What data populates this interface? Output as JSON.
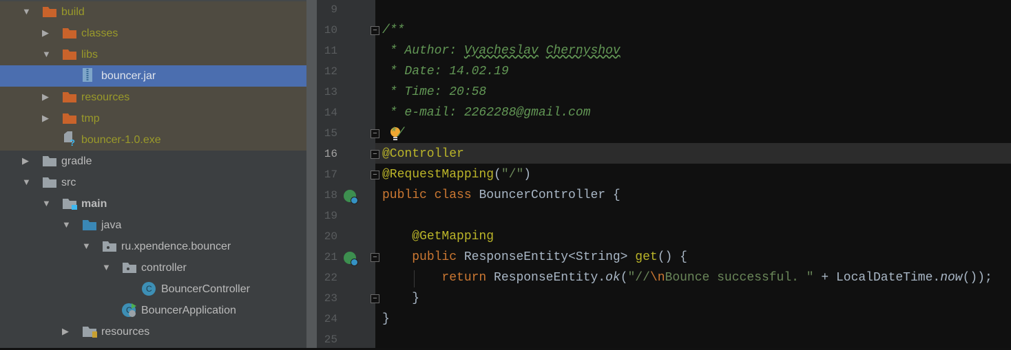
{
  "tree": [
    {
      "label": "build",
      "level": 1,
      "arrow": "open",
      "icon": "folder-orange",
      "style": "bld olive"
    },
    {
      "label": "classes",
      "level": 2,
      "arrow": "closed",
      "icon": "folder-orange",
      "style": "bld olive"
    },
    {
      "label": "libs",
      "level": 2,
      "arrow": "open",
      "icon": "folder-orange",
      "style": "bld olive"
    },
    {
      "label": "bouncer.jar",
      "level": 3,
      "arrow": "",
      "icon": "jar",
      "style": "sel"
    },
    {
      "label": "resources",
      "level": 2,
      "arrow": "closed",
      "icon": "folder-orange",
      "style": "bld olive"
    },
    {
      "label": "tmp",
      "level": 2,
      "arrow": "closed",
      "icon": "folder-orange",
      "style": "bld olive"
    },
    {
      "label": "bouncer-1.0.exe",
      "level": 2,
      "arrow": "",
      "icon": "unknown-file",
      "style": "bld olive"
    },
    {
      "label": "gradle",
      "level": 1,
      "arrow": "closed",
      "icon": "folder-gray",
      "style": ""
    },
    {
      "label": "src",
      "level": 1,
      "arrow": "open",
      "icon": "folder-gray",
      "style": ""
    },
    {
      "label": "main",
      "level": 2,
      "arrow": "open",
      "icon": "folder-source-root",
      "style": "bold"
    },
    {
      "label": "java",
      "level": 3,
      "arrow": "open",
      "icon": "folder-blue",
      "style": ""
    },
    {
      "label": "ru.xpendence.bouncer",
      "level": 4,
      "arrow": "open",
      "icon": "package",
      "style": ""
    },
    {
      "label": "controller",
      "level": 5,
      "arrow": "open",
      "icon": "package",
      "style": ""
    },
    {
      "label": "BouncerController",
      "level": 6,
      "arrow": "",
      "icon": "class",
      "style": ""
    },
    {
      "label": "BouncerApplication",
      "level": 5,
      "arrow": "",
      "icon": "spring-app-class",
      "style": ""
    },
    {
      "label": "resources",
      "level": 3,
      "arrow": "closed",
      "icon": "folder-resources",
      "style": ""
    }
  ],
  "editor": {
    "current_line": 16,
    "lines": [
      {
        "n": "9",
        "tokens": []
      },
      {
        "n": "10",
        "fold": "open",
        "tokens": [
          [
            "com",
            "/**"
          ]
        ]
      },
      {
        "n": "11",
        "tokens": [
          [
            "com",
            " * Author: "
          ],
          [
            "com t-sq",
            "Vyacheslav"
          ],
          [
            "com",
            " "
          ],
          [
            "com t-sq",
            "Chernyshov"
          ]
        ]
      },
      {
        "n": "12",
        "tokens": [
          [
            "com",
            " * Date: 14.02.19"
          ]
        ]
      },
      {
        "n": "13",
        "tokens": [
          [
            "com",
            " * Time: 20:58"
          ]
        ]
      },
      {
        "n": "14",
        "tokens": [
          [
            "com",
            " * e-mail: 2262288@gmail.com"
          ]
        ]
      },
      {
        "n": "15",
        "fold": "close",
        "bulb": true,
        "tokens": [
          [
            "com",
            " */"
          ]
        ]
      },
      {
        "n": "16",
        "fold": "open",
        "tokens": [
          [
            "ann",
            "@Controller"
          ]
        ]
      },
      {
        "n": "17",
        "fold": "close",
        "tokens": [
          [
            "ann",
            "@RequestMapping"
          ],
          [
            "",
            "("
          ],
          [
            "str",
            "\"/\""
          ],
          [
            "",
            ")"
          ]
        ]
      },
      {
        "n": "18",
        "gutter": "spring-bean-icon",
        "tokens": [
          [
            "kw",
            "public class "
          ],
          [
            "",
            "BouncerController {"
          ]
        ]
      },
      {
        "n": "19",
        "tokens": []
      },
      {
        "n": "20",
        "tokens": [
          [
            "",
            "    "
          ],
          [
            "ann",
            "@GetMapping"
          ]
        ]
      },
      {
        "n": "21",
        "gutter": "spring-web-mapping-icon",
        "fold": "open",
        "tokens": [
          [
            "",
            "    "
          ],
          [
            "kw",
            "public "
          ],
          [
            "",
            "ResponseEntity<String> "
          ],
          [
            "ann",
            "get"
          ],
          [
            "",
            "() {"
          ]
        ]
      },
      {
        "n": "22",
        "tokens": [
          [
            "",
            "        "
          ],
          [
            "kw",
            "return "
          ],
          [
            "",
            "ResponseEntity."
          ],
          [
            "it",
            "ok"
          ],
          [
            "",
            "("
          ],
          [
            "str",
            "\"//"
          ],
          [
            "esc",
            "\\n"
          ],
          [
            "str",
            "Bounce successful. \""
          ],
          [
            "",
            " + LocalDateTime."
          ],
          [
            "it",
            "now"
          ],
          [
            "",
            "());"
          ]
        ]
      },
      {
        "n": "23",
        "fold": "close",
        "tokens": [
          [
            "",
            "    }"
          ]
        ]
      },
      {
        "n": "24",
        "tokens": [
          [
            "",
            "}"
          ]
        ]
      },
      {
        "n": "25",
        "tokens": []
      }
    ]
  },
  "colors": {
    "selection": "#4b6eaf",
    "keyword": "#cc7832",
    "annotation": "#bbb529",
    "string": "#6a8759",
    "comment": "#629755"
  }
}
